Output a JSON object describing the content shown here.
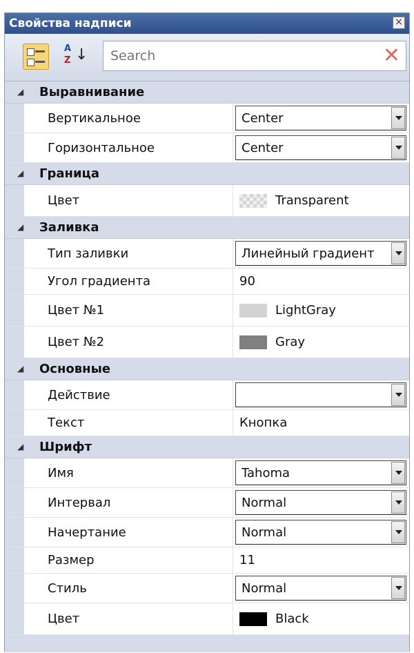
{
  "window": {
    "title": "Свойства надписи",
    "close_glyph": "×"
  },
  "toolbar": {
    "categorized_icon": "categorized-icon",
    "sort_icon": "sort-alphabetical-icon",
    "sort_a": "A",
    "sort_z": "Z",
    "sort_arrow": "↓",
    "search_placeholder": "Search",
    "clear_glyph": "✕",
    "clear_color": "#e06a60"
  },
  "groups": [
    {
      "name": "Выравнивание",
      "rows": [
        {
          "label": "Вертикальное",
          "value": "Center",
          "kind": "dropdown"
        },
        {
          "label": "Горизонтальное",
          "value": "Center",
          "kind": "dropdown"
        }
      ]
    },
    {
      "name": "Граница",
      "rows": [
        {
          "label": "Цвет",
          "value": "Transparent",
          "kind": "color",
          "swatch": "transparent"
        }
      ]
    },
    {
      "name": "Заливка",
      "rows": [
        {
          "label": "Тип заливки",
          "value": "Линейный градиент",
          "kind": "dropdown"
        },
        {
          "label": "Угол градиента",
          "value": "90",
          "kind": "text"
        },
        {
          "label": "Цвет №1",
          "value": "LightGray",
          "kind": "color",
          "swatch": "#d3d3d3"
        },
        {
          "label": "Цвет №2",
          "value": "Gray",
          "kind": "color",
          "swatch": "#808080"
        }
      ]
    },
    {
      "name": "Основные",
      "rows": [
        {
          "label": "Действие",
          "value": "",
          "kind": "dropdown"
        },
        {
          "label": "Текст",
          "value": "Кнопка",
          "kind": "text"
        }
      ]
    },
    {
      "name": "Шрифт",
      "rows": [
        {
          "label": "Имя",
          "value": "Tahoma",
          "kind": "dropdown"
        },
        {
          "label": "Интервал",
          "value": "Normal",
          "kind": "dropdown"
        },
        {
          "label": "Начертание",
          "value": "Normal",
          "kind": "dropdown"
        },
        {
          "label": "Размер",
          "value": "11",
          "kind": "text"
        },
        {
          "label": "Стиль",
          "value": "Normal",
          "kind": "dropdown"
        },
        {
          "label": "Цвет",
          "value": "Black",
          "kind": "color",
          "swatch": "#000000"
        }
      ]
    }
  ]
}
